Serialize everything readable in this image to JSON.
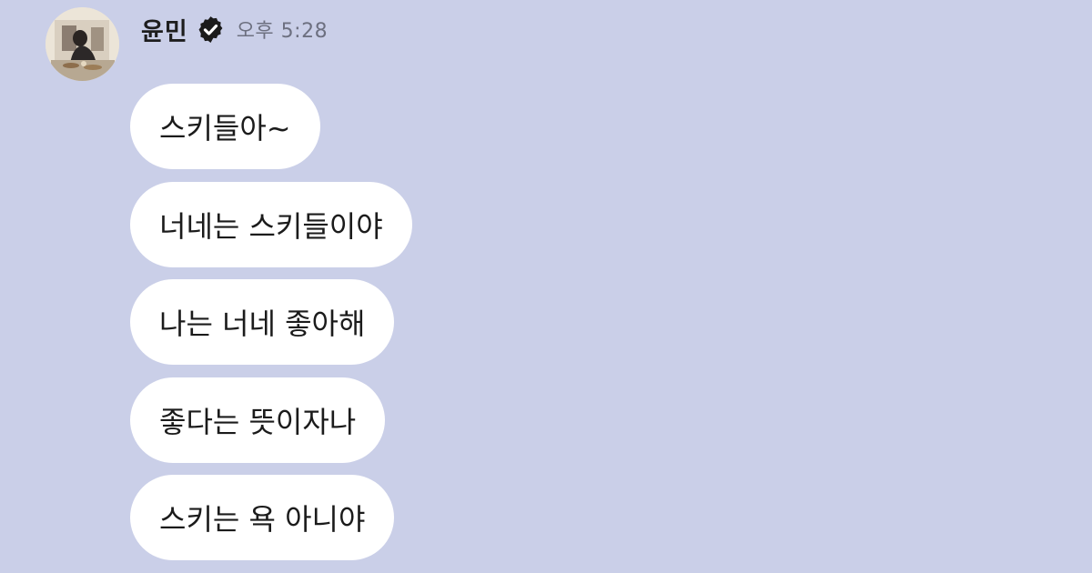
{
  "sender": {
    "name": "윤민",
    "time": "오후 5:28",
    "avatar_icon": "profile-photo",
    "verified_icon": "verified-badge-icon"
  },
  "messages": [
    {
      "text": "스키들아~"
    },
    {
      "text": "너네는 스키들이야"
    },
    {
      "text": "나는 너네 좋아해"
    },
    {
      "text": "좋다는 뜻이자나"
    },
    {
      "text": "스키는 욕 아니야"
    }
  ],
  "colors": {
    "background": "#cacfe8",
    "bubble": "#ffffff",
    "text": "#1b1b1b",
    "timestamp": "#6d7080"
  }
}
